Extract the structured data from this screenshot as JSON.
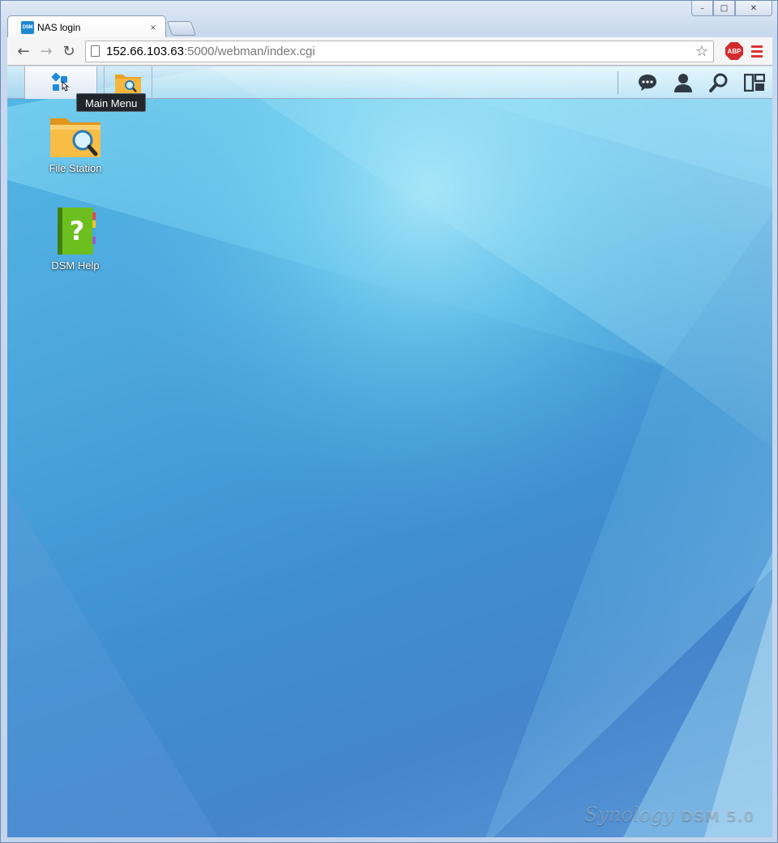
{
  "browser": {
    "tab": {
      "favicon_text": "DSM",
      "title": "NAS login",
      "close_glyph": "×"
    },
    "window_controls": {
      "minimize": "–",
      "maximize": "□",
      "close": "✕"
    },
    "nav": {
      "back": "←",
      "forward": "→",
      "reload": "↻"
    },
    "url": {
      "host": "152.66.103.63",
      "rest": ":5000/webman/index.cgi"
    },
    "bookmark_glyph": "☆",
    "abp_label": "ABP"
  },
  "dsm": {
    "taskbar": {
      "main_menu_icon": "main-menu-icon",
      "app_icon": "file-station-icon",
      "right_icons": [
        "notifications-icon",
        "user-icon",
        "search-icon",
        "widgets-icon"
      ]
    },
    "tooltip": "Main Menu",
    "desktop_icons": [
      {
        "label": "File Station",
        "icon": "file-station-icon"
      },
      {
        "label": "DSM Help",
        "icon": "dsm-help-icon"
      }
    ],
    "brand": {
      "name": "Synology",
      "product": "DSM 5.0"
    }
  },
  "colors": {
    "desktop_bg": "#4a9fd8",
    "tooltip_bg": "#20262c",
    "abp_red": "#d32b2b",
    "folder_yellow": "#f6b73c",
    "help_green": "#6cbf1f"
  }
}
